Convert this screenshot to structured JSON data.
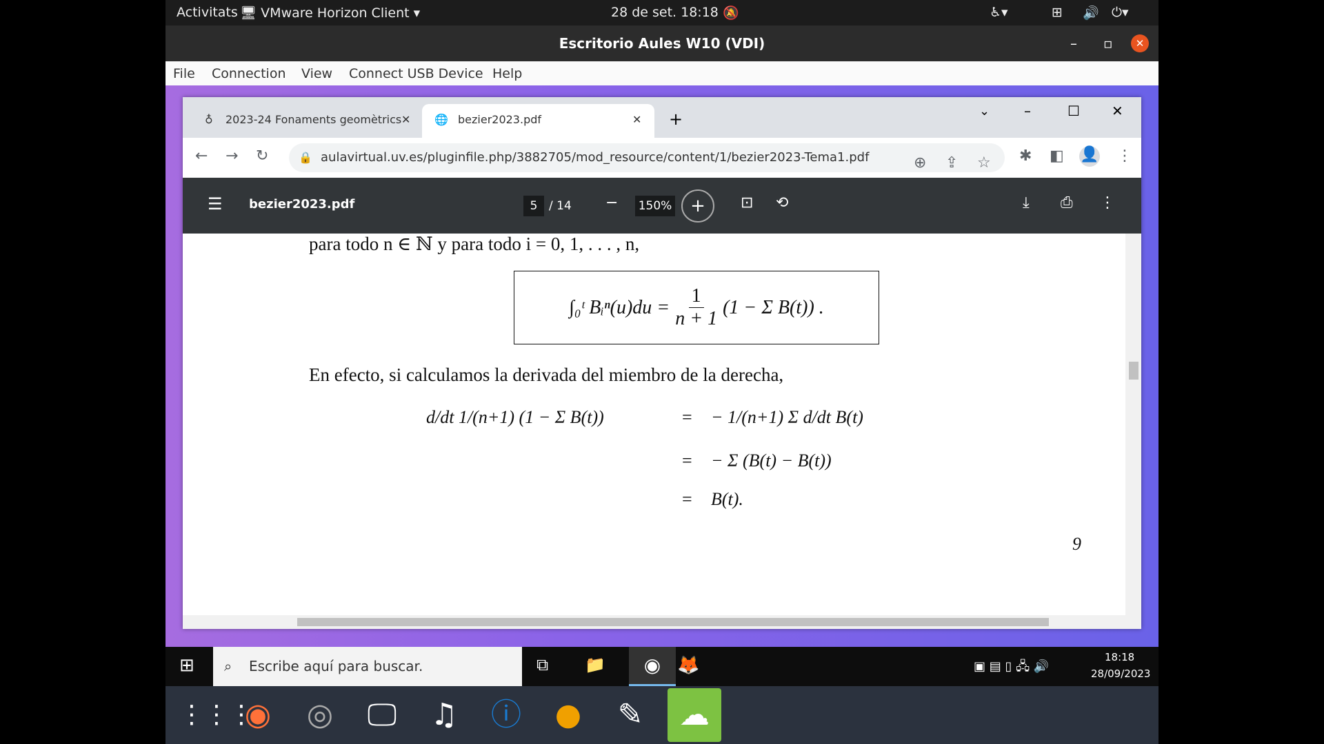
{
  "topbar": {
    "activities": "Activitats",
    "app": "VMware Horizon Client ▾",
    "clock": "28 de set.  18:18"
  },
  "window": {
    "title": "Escritorio Aules W10 (VDI)"
  },
  "menu": [
    "File",
    "Connection",
    "View",
    "Connect USB Device",
    "Help"
  ],
  "browser": {
    "tabs": [
      {
        "label": "2023-24 Fonaments geomètrics"
      },
      {
        "label": "bezier2023.pdf"
      }
    ],
    "url": "aulavirtual.uv.es/pluginfile.php/3882705/mod_resource/content/1/bezier2023-Tema1.pdf"
  },
  "pdf": {
    "filename": "bezier2023.pdf",
    "page": "5",
    "total": "/ 14",
    "zoom": "150%"
  },
  "doc": {
    "line1": "para todo n ∈ ℕ y para todo i = 0, 1, . . . , n,",
    "boxed_lhs": "∫₀ᵗ Bᵢⁿ(u)du =",
    "boxed_frac_num": "1",
    "boxed_frac_den": "n + 1",
    "boxed_rhs": "(1 − Σ B(t)) .",
    "line2": "En efecto, si calculamos la derivada del miembro de la derecha,",
    "eq1_lhs": "d/dt 1/(n+1) (1 − Σ B(t))",
    "eq1_rhs": "− 1/(n+1) Σ d/dt B(t)",
    "eq2_rhs": "− Σ (B(t) − B(t))",
    "eq3_rhs": "B(t).",
    "equals": "=",
    "page_number": "9"
  },
  "taskbar": {
    "search_placeholder": "Escribe aquí para buscar.",
    "time": "18:18",
    "date": "28/09/2023"
  }
}
